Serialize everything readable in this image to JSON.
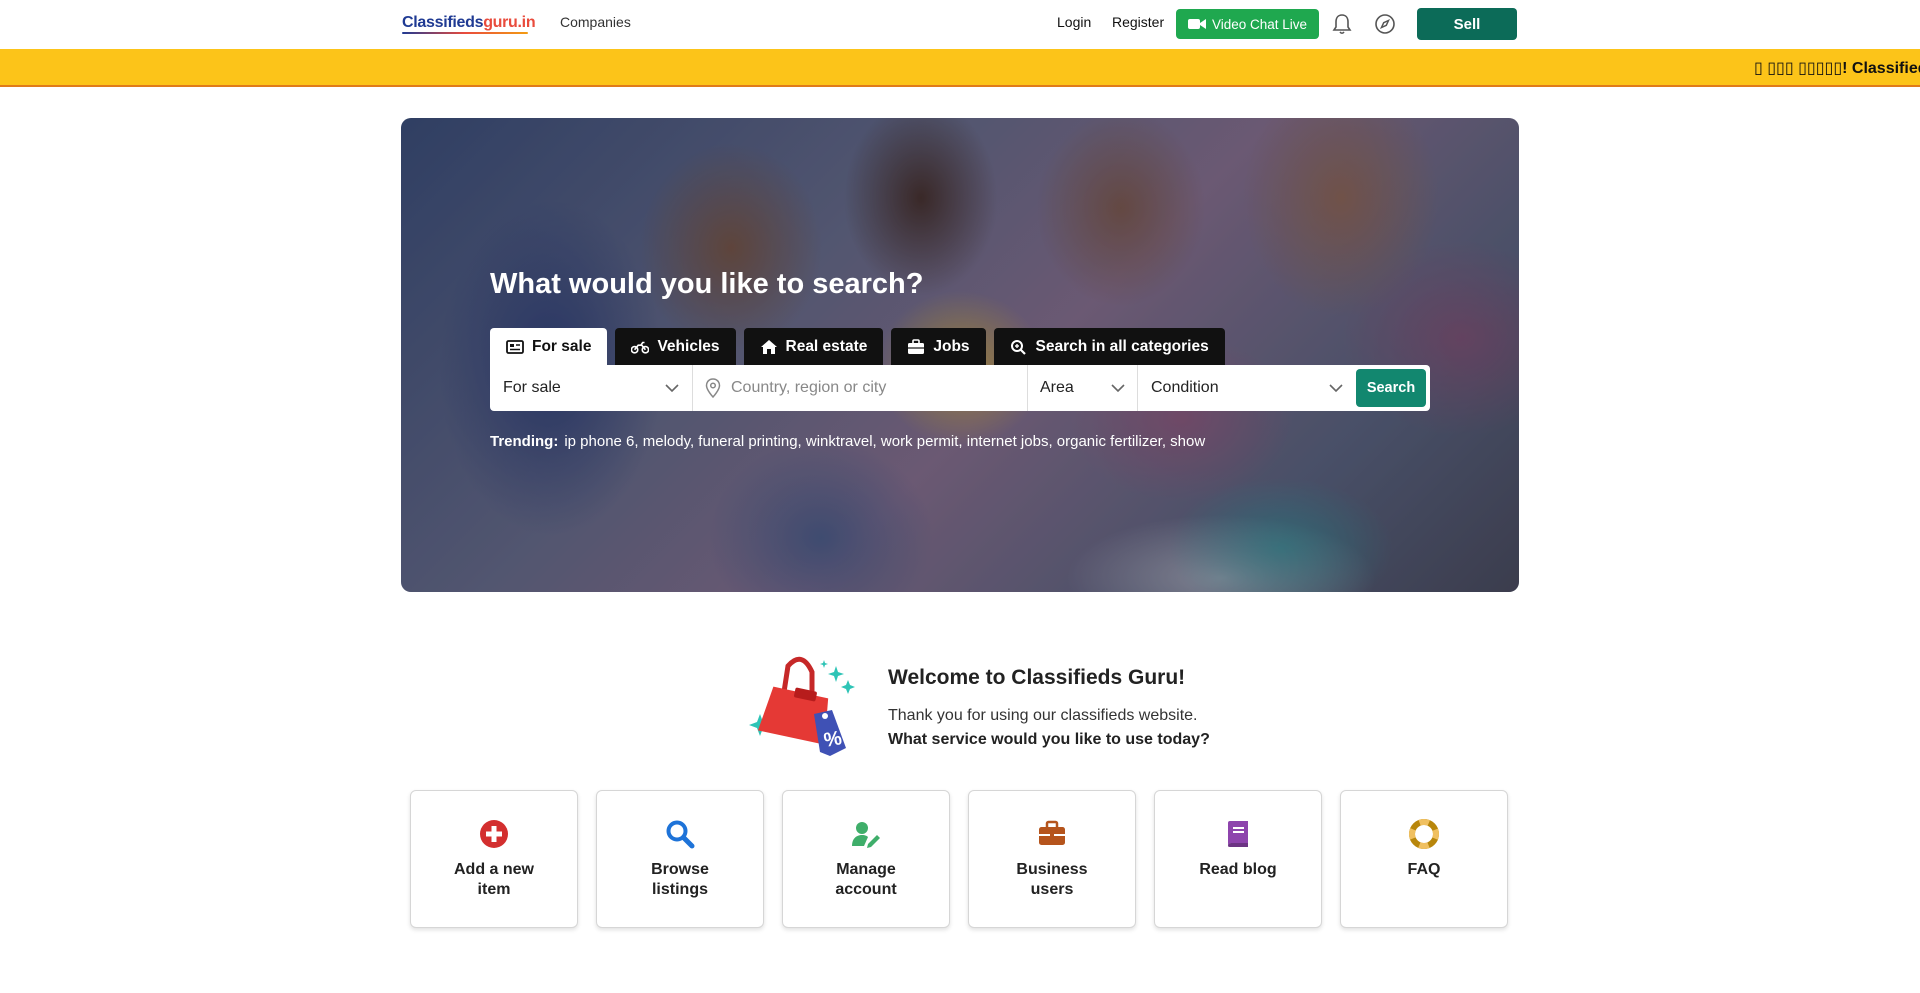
{
  "header": {
    "logo_part1": "Classifieds",
    "logo_part2": "guru.in",
    "companies_label": "Companies",
    "login_label": "Login",
    "register_label": "Register",
    "video_chat_label": "Video Chat Live",
    "sell_label": "Sell",
    "icons": [
      "video-camera-icon",
      "bell-icon",
      "compass-icon"
    ]
  },
  "ticker": {
    "text": "▯ ▯▯▯ ▯▯▯▯▯! ClassifiedsG"
  },
  "hero": {
    "title": "What would you like to search?",
    "tabs": [
      {
        "label": "For sale",
        "icon": "newspaper-icon",
        "active": true
      },
      {
        "label": "Vehicles",
        "icon": "motorcycle-icon",
        "active": false
      },
      {
        "label": "Real estate",
        "icon": "house-icon",
        "active": false
      },
      {
        "label": "Jobs",
        "icon": "briefcase-icon",
        "active": false
      },
      {
        "label": "Search in all categories",
        "icon": "search-icon",
        "active": false
      }
    ],
    "search": {
      "category_value": "For sale",
      "location_placeholder": "Country, region or city",
      "area_value": "Area",
      "condition_value": "Condition",
      "search_label": "Search"
    },
    "trending_label": "Trending:",
    "trending_items": "ip phone 6, melody, funeral printing, winktravel, work permit, internet jobs, organic fertilizer, show"
  },
  "welcome": {
    "title": "Welcome to Classifieds Guru!",
    "subtitle": "Thank you for using our classifieds website.",
    "question": "What service would you like to use today?"
  },
  "services": [
    {
      "label": "Add a new item",
      "icon": "plus-circle-icon",
      "color": "#d32f2f"
    },
    {
      "label": "Browse listings",
      "icon": "search-icon",
      "color": "#1e73d8"
    },
    {
      "label": "Manage account",
      "icon": "user-edit-icon",
      "color": "#3fae6a"
    },
    {
      "label": "Business users",
      "icon": "briefcase-icon",
      "color": "#b5541c"
    },
    {
      "label": "Read blog",
      "icon": "book-icon",
      "color": "#8e44ad"
    },
    {
      "label": "FAQ",
      "icon": "life-ring-icon",
      "color": "#b8860b"
    }
  ],
  "colors": {
    "brand_green": "#0c6b58",
    "video_green": "#1fa84f",
    "ticker_yellow": "#fcc419",
    "search_green": "#12876f"
  }
}
